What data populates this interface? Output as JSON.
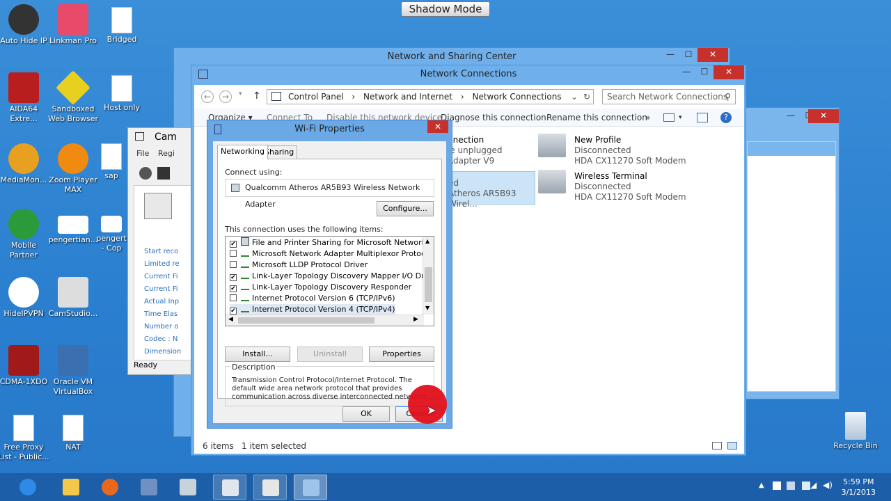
{
  "shadow_mode": "Shadow Mode",
  "desktop_icons": [
    {
      "label": "Auto Hide IP"
    },
    {
      "label": "Linkman Pro"
    },
    {
      "label": "Bridged"
    },
    {
      "label": "AIDA64 Extre..."
    },
    {
      "label": "Sandboxed Web Browser"
    },
    {
      "label": "Host only"
    },
    {
      "label": "MediaMon..."
    },
    {
      "label": "Zoom Player MAX"
    },
    {
      "label": "sap"
    },
    {
      "label": "Mobile Partner"
    },
    {
      "label": "pengertian..."
    },
    {
      "label": "pengert - Cop"
    },
    {
      "label": "HideIPVPN"
    },
    {
      "label": "CamStudio..."
    },
    {
      "label": "CDMA-1XDO"
    },
    {
      "label": "Oracle VM VirtualBox"
    },
    {
      "label": "Free Proxy List - Public..."
    },
    {
      "label": "NAT"
    },
    {
      "label": "Recycle Bin"
    }
  ],
  "sharing_center": {
    "title": "Network and Sharing Center"
  },
  "net_conn": {
    "title": "Network Connections",
    "breadcrumb": [
      "Control Panel",
      "Network and Internet",
      "Network Connections"
    ],
    "search_placeholder": "Search Network Connections",
    "toolbar": {
      "organize": "Organize ▾",
      "connect": "Connect To",
      "disable": "Disable this network device",
      "diagnose": "Diagnose this connection",
      "rename": "Rename this connection",
      "more": "»"
    },
    "items": [
      {
        "name": "nnection",
        "status": "le unplugged",
        "device": "Adapter V9"
      },
      {
        "name": "",
        "status": "ed",
        "device": "Atheros AR5B93 Wirel..."
      },
      {
        "name": "New Profile",
        "status": "Disconnected",
        "device": "HDA CX11270 Soft Modem"
      },
      {
        "name": "Wireless Terminal",
        "status": "Disconnected",
        "device": "HDA CX11270 Soft Modem"
      }
    ],
    "status": {
      "count": "6 items",
      "selected": "1 item selected"
    }
  },
  "camstudio": {
    "title": "Cam",
    "menu": [
      "File",
      "Regi"
    ],
    "lines": [
      "Start reco",
      "Limited re",
      "Current Fi",
      "Current Fi",
      "Actual Inp",
      "Time Elas",
      "Number o",
      "Codec : N",
      "Dimension"
    ],
    "status": "Ready"
  },
  "wifi": {
    "title": "Wi-Fi Properties",
    "tabs": [
      "Networking",
      "Sharing"
    ],
    "connect_using": "Connect using:",
    "adapter": "Qualcomm Atheros AR5B93 Wireless Network Adapter",
    "configure": "Configure...",
    "items_label": "This connection uses the following items:",
    "items": [
      {
        "label": "File and Printer Sharing for Microsoft Networks",
        "checked": "✔"
      },
      {
        "label": "Microsoft Network Adapter Multiplexor Protocol",
        "checked": ""
      },
      {
        "label": "Microsoft LLDP Protocol Driver",
        "checked": ""
      },
      {
        "label": "Link-Layer Topology Discovery Mapper I/O Driver",
        "checked": "✔"
      },
      {
        "label": "Link-Layer Topology Discovery Responder",
        "checked": "✔"
      },
      {
        "label": "Internet Protocol Version 6 (TCP/IPv6)",
        "checked": ""
      },
      {
        "label": "Internet Protocol Version 4 (TCP/IPv4)",
        "checked": "✔"
      }
    ],
    "install": "Install...",
    "uninstall": "Uninstall",
    "properties": "Properties",
    "description_label": "Description",
    "description": "Transmission Control Protocol/Internet Protocol. The default wide area network protocol that provides communication across diverse interconnected networks.",
    "ok": "OK",
    "cancel": "Cancel"
  },
  "taskbar": {
    "time": "5:59 PM",
    "date": "3/1/2013"
  },
  "colors": {
    "close": "#c7302b",
    "taskbar": "#1c5fa8",
    "cursor_highlight": "#e0101a"
  }
}
